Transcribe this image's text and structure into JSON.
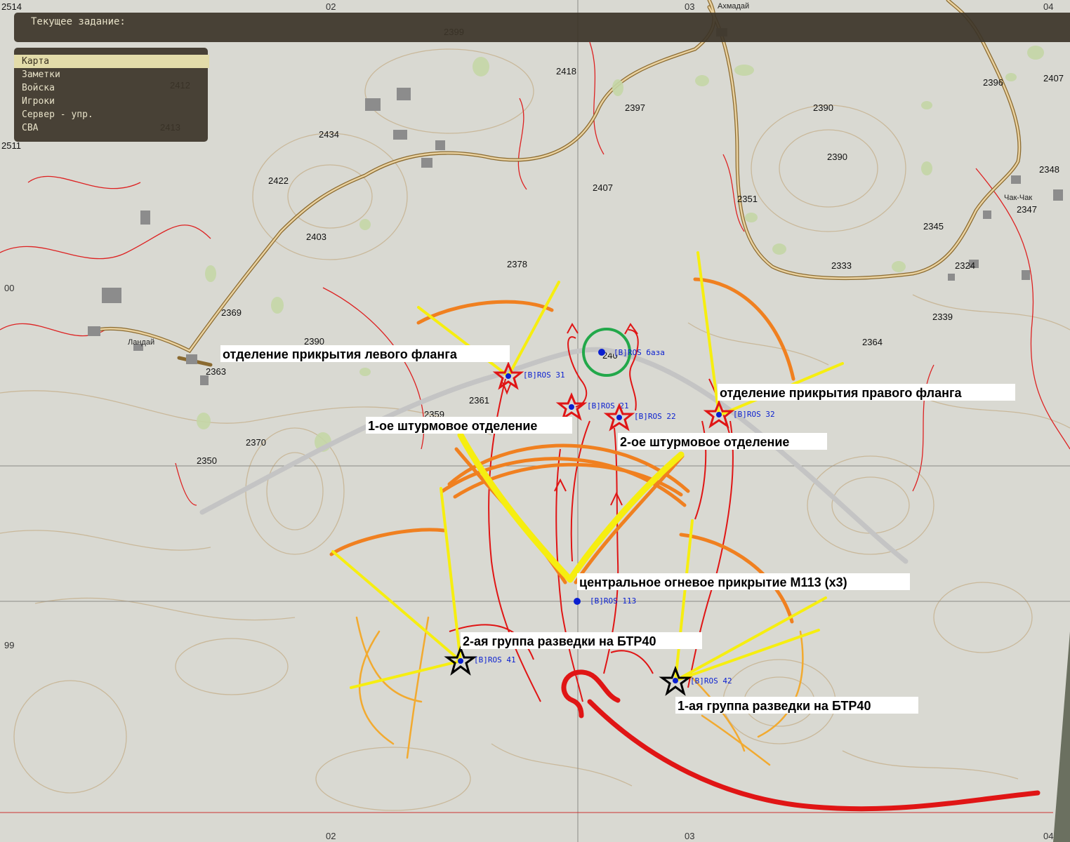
{
  "task_bar": {
    "label": "Текущее задание:"
  },
  "menu": {
    "items": [
      {
        "label": "Карта",
        "active": true
      },
      {
        "label": "Заметки",
        "active": false
      },
      {
        "label": "Войска",
        "active": false
      },
      {
        "label": "Игроки",
        "active": false
      },
      {
        "label": "Сервер - упр.",
        "active": false
      },
      {
        "label": "СВА",
        "active": false
      }
    ]
  },
  "grid_labels": {
    "top_02": "02",
    "top_03": "03",
    "bottom_02": "02",
    "bottom_03": "03",
    "left_00": "00",
    "left_99": "99",
    "corner_2514": "2514",
    "corner_2511": "2511",
    "top_04": "04",
    "bottom_04": "04"
  },
  "towns": {
    "akhmaday": "Ахмадай",
    "landay": "Ландай",
    "chak_chak": "Чак-Чак"
  },
  "elevations": {
    "e2399": "2399",
    "e2418": "2418",
    "e2412": "2412",
    "e2413": "2413",
    "e2397": "2397",
    "e2434": "2434",
    "e2390a": "2390",
    "e2396": "2396",
    "e2407a": "2407",
    "e2390b": "2390",
    "e2422": "2422",
    "e2407b": "2407",
    "e2348": "2348",
    "e2351": "2351",
    "e2347": "2347",
    "e2403": "2403",
    "e2345": "2345",
    "e2378": "2378",
    "e2333": "2333",
    "e2324": "2324",
    "e2369": "2369",
    "e2339": "2339",
    "e2390c": "2390",
    "e2364": "2364",
    "e2363": "2363",
    "e2361": "2361",
    "e2359": "2359",
    "e2370": "2370",
    "e2350": "2350",
    "e240": "240"
  },
  "units": {
    "base": "[B]ROS база",
    "u31": "[B]ROS 31",
    "u21": "[B]ROS 21",
    "u22": "[B]ROS 22",
    "u32": "[B]ROS 32",
    "u113": "[B]ROS 113",
    "u41": "[B]ROS 41",
    "u42": "[B]ROS 42"
  },
  "annotations": {
    "left_flank": "отделение прикрытия левого фланга",
    "right_flank": "отделение прикрытия правого фланга",
    "assault1": "1-ое штурмовое отделение",
    "assault2": "2-ое штурмовое отделение",
    "central": "центральное огневое прикрытие М113 (x3)",
    "recon2": "2-ая группа разведки на БТР40",
    "recon1": "1-ая группа разведки на БТР40"
  },
  "colors": {
    "map_bg": "#d9d9d2",
    "contour": "#c9b89a",
    "red_contour": "#d22",
    "road": "#c89a4a",
    "grid": "#8a8a86",
    "marker_red": "#e01515",
    "marker_blue": "#0a1fd0",
    "orange": "#f08020",
    "yellow": "#f6ee10",
    "green_circle": "#22a84a"
  }
}
